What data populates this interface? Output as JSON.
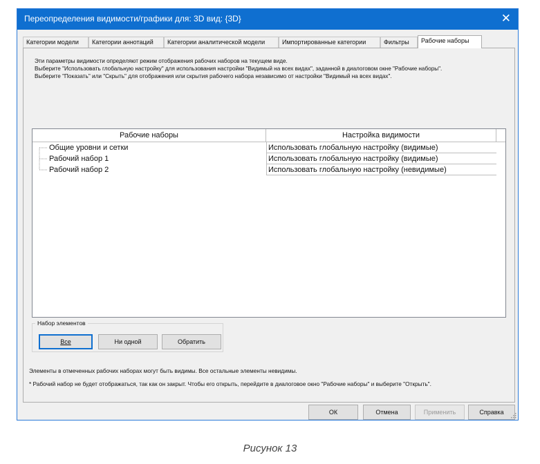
{
  "dialog": {
    "title": "Переопределения видимости/графики для: 3D вид: {3D}",
    "close_glyph": "✕"
  },
  "tabs": [
    {
      "label": "Категории модели",
      "active": false
    },
    {
      "label": "Категории аннотаций",
      "active": false
    },
    {
      "label": "Категории аналитической модели",
      "active": false
    },
    {
      "label": "Импортированные категории",
      "active": false
    },
    {
      "label": "Фильтры",
      "active": false
    },
    {
      "label": "Рабочие наборы",
      "active": true
    }
  ],
  "description": {
    "line1": "Эти параметры видимости определяют режим отображения рабочих наборов на текущем виде.",
    "line2": "Выберите \"Использовать глобальную настройку\" для использования настройки \"Видимый на всех видах\", заданной в диалоговом окне \"Рабочие наборы\".",
    "line3": "Выберите \"Показать\" или \"Скрыть\" для отображения или скрытия рабочего набора независимо от настройки \"Видимый на всех видах\"."
  },
  "table": {
    "headers": [
      "Рабочие наборы",
      "Настройка видимости"
    ],
    "rows": [
      {
        "name": "Общие уровни и сетки",
        "visibility": "Использовать глобальную настройку (видимые)"
      },
      {
        "name": "Рабочий набор 1",
        "visibility": "Использовать глобальную настройку (видимые)"
      },
      {
        "name": "Рабочий набор 2",
        "visibility": "Использовать глобальную настройку (невидимые)"
      }
    ]
  },
  "selection_group": {
    "legend": "Набор элементов",
    "all_label": "Все",
    "none_label": "Ни одной",
    "invert_label": "Обратить"
  },
  "notes": {
    "visible_note": "Элементы в отмеченных рабочих наборах могут быть видимы.  Все остальные элементы невидимы.",
    "closed_note": "* Рабочий набор не будет отображаться, так как он закрыт. Чтобы его открыть, перейдите в диалоговое окно \"Рабочие наборы\" и выберите \"Открыть\"."
  },
  "footer": {
    "ok_label": "ОК",
    "cancel_label": "Отмена",
    "apply_label": "Применить",
    "help_label": "Справка"
  },
  "caption": "Рисунок 13",
  "colors": {
    "titlebar": "#0f6fd0",
    "window_bg": "#f0f0f0"
  }
}
